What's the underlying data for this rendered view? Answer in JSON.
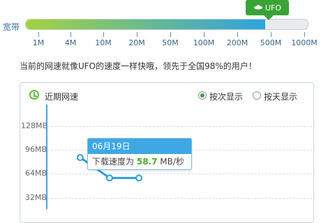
{
  "meter": {
    "label": "宽带",
    "fill_fraction": 0.85,
    "ticks": [
      "1M",
      "4M",
      "10M",
      "20M",
      "50M",
      "100M",
      "200M",
      "500M",
      "1000M"
    ],
    "badge_label": "UFO",
    "fill_start_color": "#a4d23f",
    "fill_end_color": "#2ea3e0"
  },
  "summary": "当前的网速就像UFO的速度一样快哦，领先于全国98%的用户！",
  "panel": {
    "title": "近期网速",
    "radio_options": [
      {
        "label": "按次显示",
        "selected": true
      },
      {
        "label": "按天显示",
        "selected": false
      }
    ]
  },
  "chart_data": {
    "type": "line",
    "title": "",
    "xlabel": "",
    "ylabel": "",
    "y_ticks": [
      "128MB",
      "96MB",
      "64MB",
      "32MB"
    ],
    "ylim": [
      0,
      150
    ],
    "series": [
      {
        "values": [
          86,
          58.7,
          58.7
        ]
      }
    ],
    "line_color": "#2f9fd5",
    "grid": true
  },
  "tooltip": {
    "date": "06月19日",
    "label_prefix": "下载速度为",
    "value": "58.7",
    "unit": "MB/秒"
  }
}
